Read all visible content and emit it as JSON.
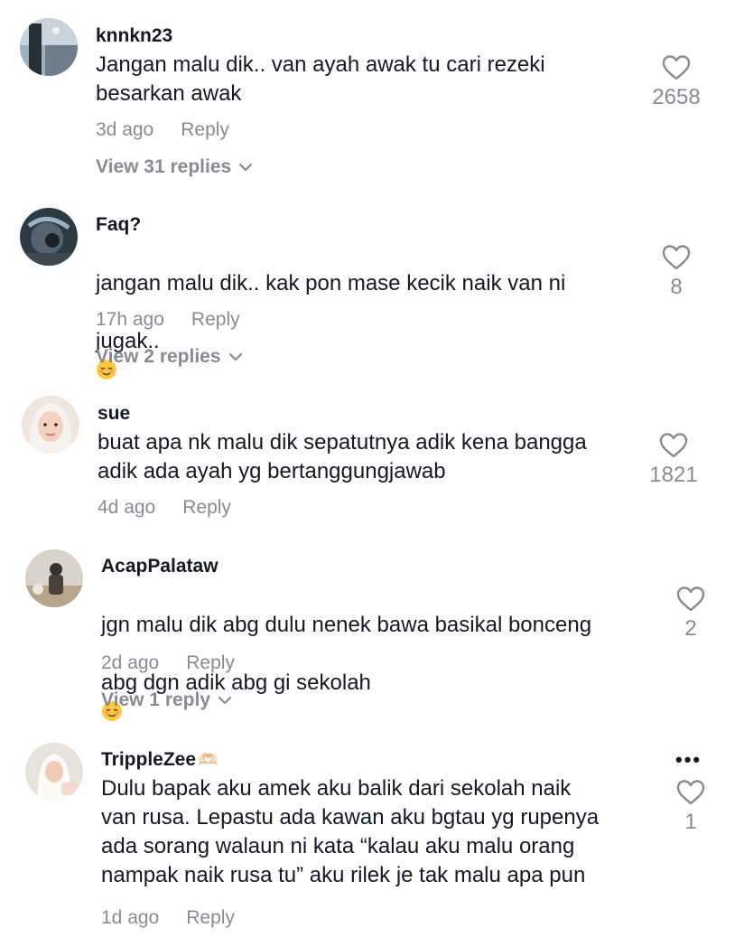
{
  "comments": [
    {
      "username": "knnkn23",
      "text": "Jangan malu dik.. van ayah awak tu cari rezeki\nbesarkan awak",
      "time": "3d ago",
      "reply_label": "Reply",
      "view_replies": "View 31 replies",
      "likes": "2658"
    },
    {
      "username": "Faq?",
      "text_line1": "jangan malu dik.. kak pon mase kecik naik van ni",
      "text_line2": "jugak..",
      "time": "17h ago",
      "reply_label": "Reply",
      "view_replies": "View 2 replies",
      "likes": "8"
    },
    {
      "username": "sue",
      "text": "buat apa nk malu dik sepatutnya adik kena bangga\nadik ada ayah yg bertanggungjawab",
      "time": "4d ago",
      "reply_label": "Reply",
      "likes": "1821"
    },
    {
      "username": "AcapPalataw",
      "text_line1": "jgn malu dik abg dulu nenek bawa basikal bonceng",
      "text_line2": "abg dgn adik abg gi sekolah",
      "time": "2d ago",
      "reply_label": "Reply",
      "view_replies": "View 1 reply",
      "likes": "2"
    },
    {
      "username": "TrippleZee",
      "username_emoji": "🫶🏻",
      "text": "Dulu bapak aku amek aku balik dari sekolah naik\nvan rusa. Lepastu ada kawan aku bgtau yg rupenya\nada sorang walaun ni kata “kalau aku malu orang\nnampak naik rusa tu” aku rilek je tak malu apa pun",
      "time": "1d ago",
      "reply_label": "Reply",
      "likes": "1",
      "more_label": "•••"
    }
  ],
  "icons": {
    "heart": "heart-outline-icon",
    "chevron": "chevron-down-icon",
    "more": "more-options-icon",
    "relieved_emoji": "relieved-face-emoji"
  },
  "colors": {
    "text": "#161823",
    "muted": "#8a8b91",
    "background": "#ffffff"
  }
}
